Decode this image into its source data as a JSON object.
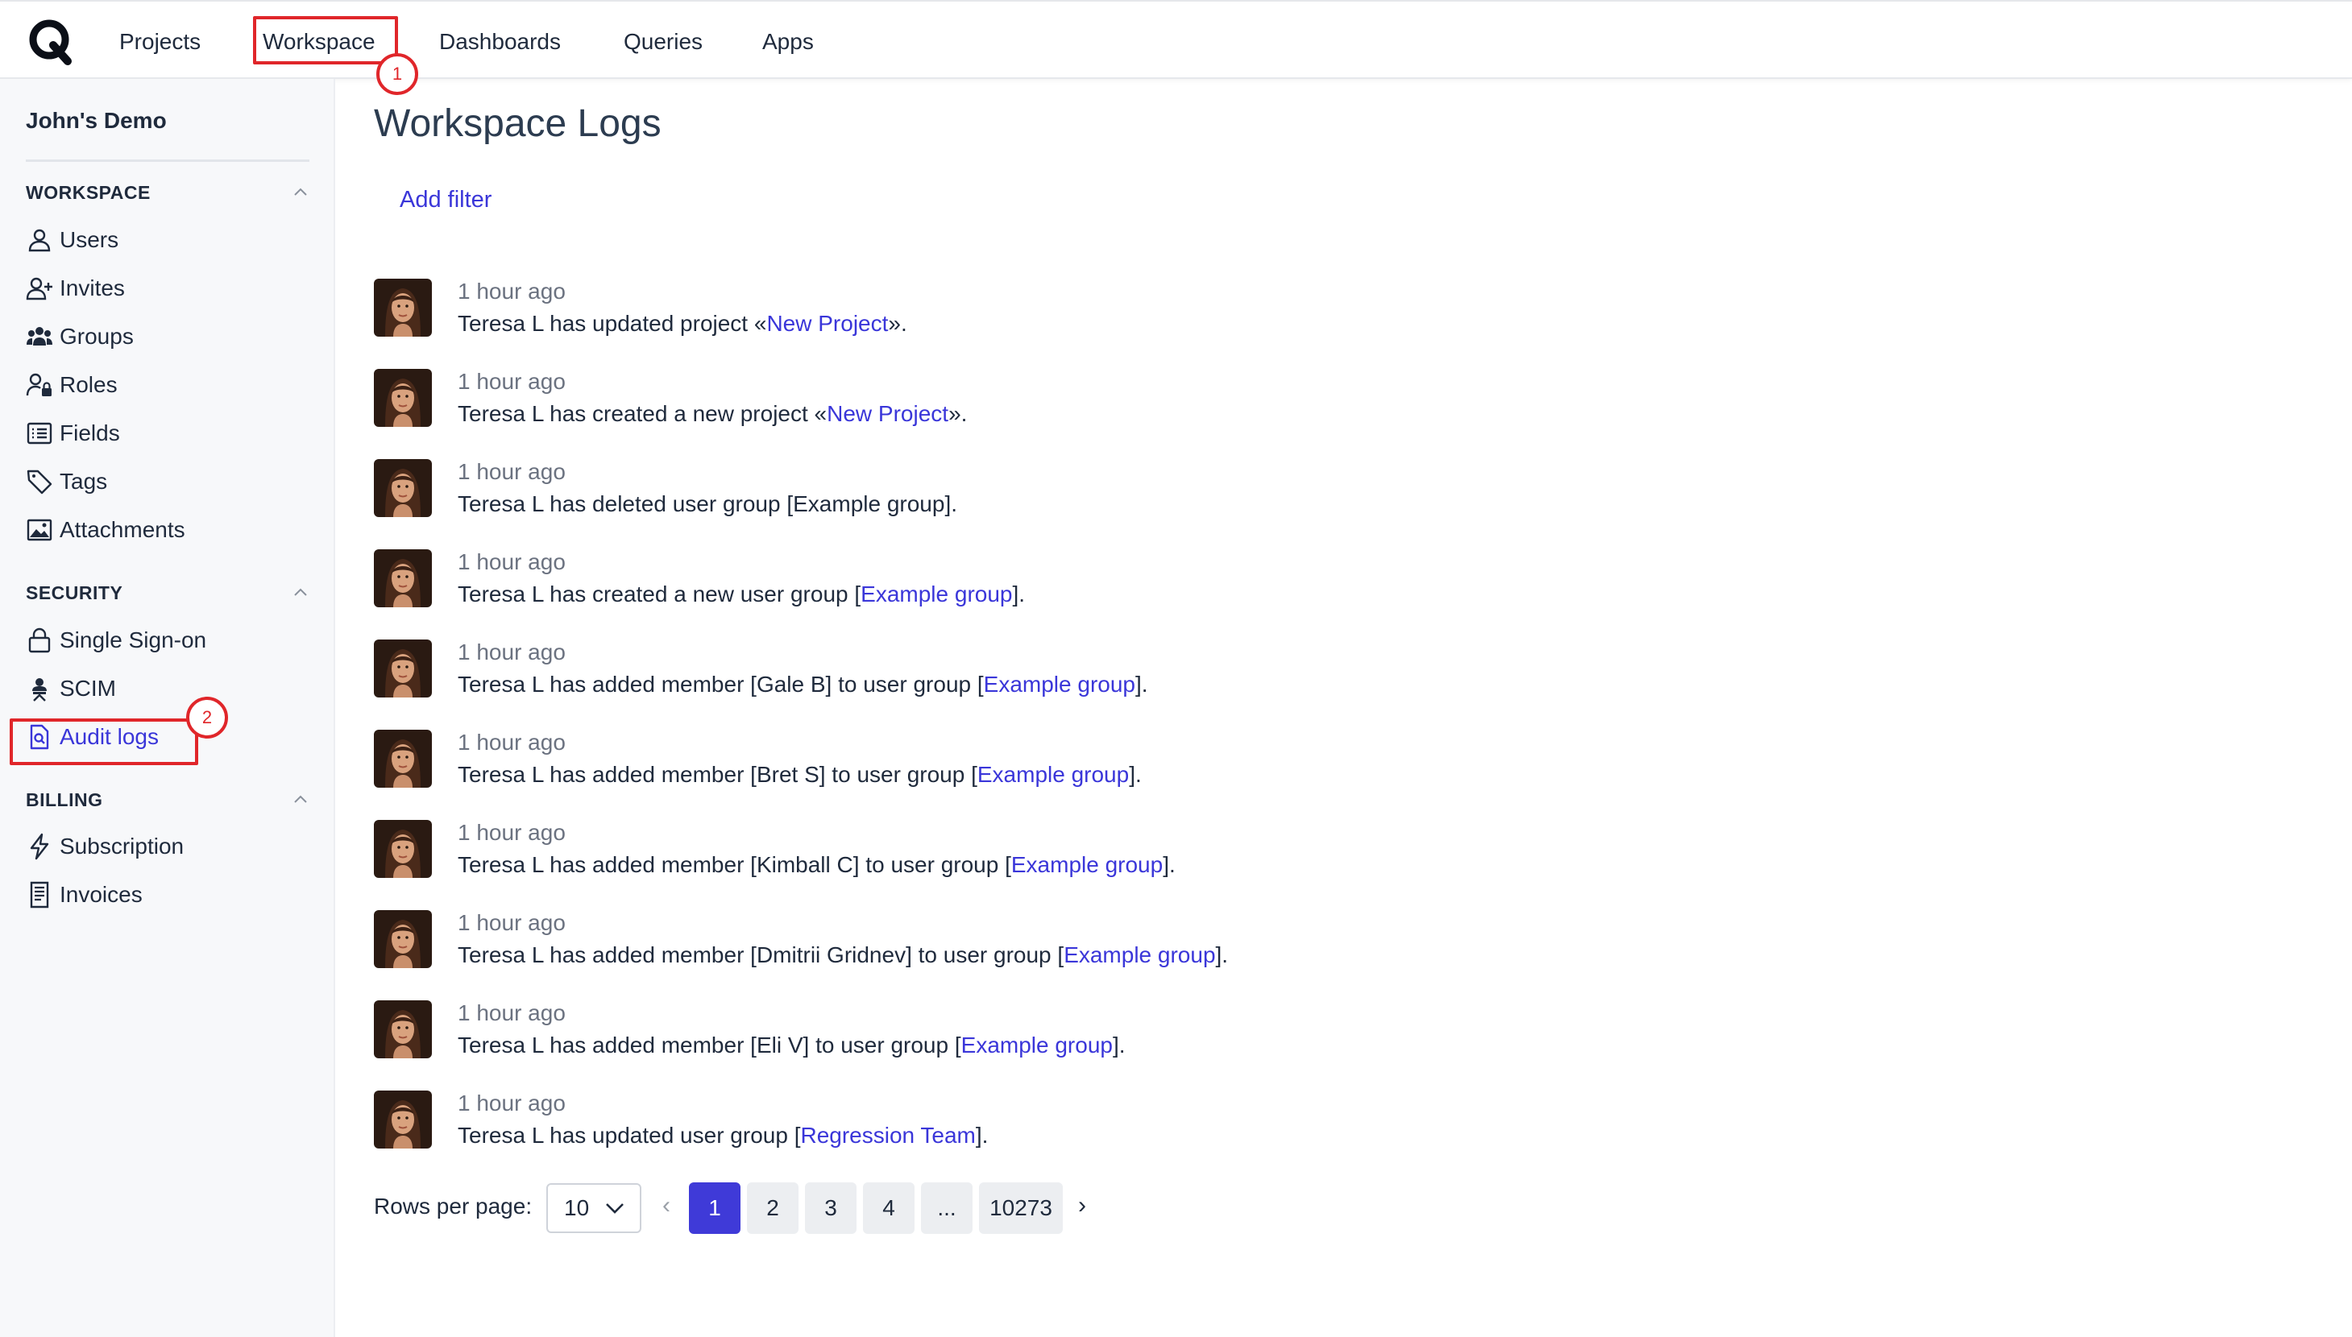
{
  "nav": {
    "items": [
      {
        "label": "Projects"
      },
      {
        "label": "Workspace"
      },
      {
        "label": "Dashboards"
      },
      {
        "label": "Queries"
      },
      {
        "label": "Apps"
      }
    ]
  },
  "annotations": {
    "step1": "1",
    "step2": "2",
    "highlight_color": "#e0262a"
  },
  "sidebar": {
    "org_name": "John's Demo",
    "sections": [
      {
        "title": "WORKSPACE",
        "items": [
          {
            "label": "Users",
            "icon": "user-icon"
          },
          {
            "label": "Invites",
            "icon": "user-plus-icon"
          },
          {
            "label": "Groups",
            "icon": "users-group-icon"
          },
          {
            "label": "Roles",
            "icon": "user-lock-icon"
          },
          {
            "label": "Fields",
            "icon": "list-icon"
          },
          {
            "label": "Tags",
            "icon": "tag-icon"
          },
          {
            "label": "Attachments",
            "icon": "image-icon"
          }
        ]
      },
      {
        "title": "SECURITY",
        "items": [
          {
            "label": "Single Sign-on",
            "icon": "lock-icon"
          },
          {
            "label": "SCIM",
            "icon": "scim-icon"
          },
          {
            "label": "Audit logs",
            "icon": "file-search-icon",
            "active": true
          }
        ]
      },
      {
        "title": "BILLING",
        "items": [
          {
            "label": "Subscription",
            "icon": "lightning-icon"
          },
          {
            "label": "Invoices",
            "icon": "receipt-icon"
          }
        ]
      }
    ]
  },
  "main": {
    "title": "Workspace Logs",
    "add_filter": "Add filter",
    "logs": [
      {
        "time": "1 hour ago",
        "pre": "Teresa L has updated project «",
        "link": "New Project",
        "post": "»."
      },
      {
        "time": "1 hour ago",
        "pre": "Teresa L has created a new project «",
        "link": "New Project",
        "post": "»."
      },
      {
        "time": "1 hour ago",
        "pre": "Teresa L has deleted user group [Example group].",
        "link": "",
        "post": ""
      },
      {
        "time": "1 hour ago",
        "pre": "Teresa L has created a new user group [",
        "link": "Example group",
        "post": "]."
      },
      {
        "time": "1 hour ago",
        "pre": "Teresa L has added member [Gale B] to user group [",
        "link": "Example group",
        "post": "]."
      },
      {
        "time": "1 hour ago",
        "pre": "Teresa L has added member [Bret S] to user group [",
        "link": "Example group",
        "post": "]."
      },
      {
        "time": "1 hour ago",
        "pre": "Teresa L has added member [Kimball C] to user group [",
        "link": "Example group",
        "post": "]."
      },
      {
        "time": "1 hour ago",
        "pre": "Teresa L has added member [Dmitrii Gridnev] to user group [",
        "link": "Example group",
        "post": "]."
      },
      {
        "time": "1 hour ago",
        "pre": "Teresa L has added member [Eli V] to user group [",
        "link": "Example group",
        "post": "]."
      },
      {
        "time": "1 hour ago",
        "pre": "Teresa L has updated user group [",
        "link": "Regression Team",
        "post": "]."
      }
    ]
  },
  "pagination": {
    "rows_label": "Rows per page:",
    "rows_value": "10",
    "prev": "‹",
    "next": "›",
    "pages": [
      "1",
      "2",
      "3",
      "4",
      "...",
      "10273"
    ],
    "current_page": "1"
  },
  "colors": {
    "accent": "#3a36d9",
    "active_page_bg": "#3f3ad8",
    "sidebar_bg": "#f7f8fa"
  }
}
